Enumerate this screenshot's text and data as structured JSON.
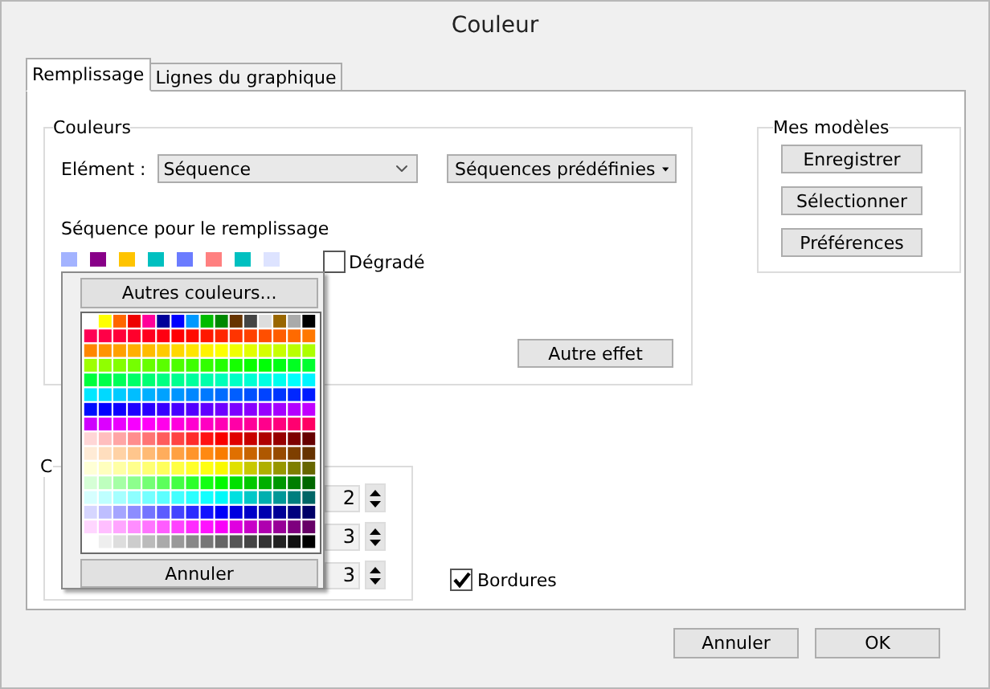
{
  "window": {
    "title": "Couleur"
  },
  "tabs": [
    {
      "label": "Remplissage",
      "selected": true
    },
    {
      "label": "Lignes du graphique",
      "selected": false
    }
  ],
  "colors_group": {
    "legend": "Couleurs",
    "element_label": "Elément :",
    "element_value": "Séquence",
    "presets_button": "Séquences prédéfinies",
    "sequence_label": "Séquence pour le remplissage",
    "swatches": [
      {
        "color": "#a3b3ff"
      },
      {
        "color": "#880088"
      },
      {
        "color": "#ffc400"
      },
      {
        "color": "#00c0c0"
      },
      {
        "color": "#6b7cff"
      },
      {
        "color": "#ff8080"
      },
      {
        "color": "#00c0c0"
      },
      {
        "color": "#dde3ff"
      }
    ],
    "gradient": {
      "label": "Dégradé",
      "checked": false
    },
    "effect_button": "Autre effet"
  },
  "templates_group": {
    "legend": "Mes modèles",
    "buttons": [
      "Enregistrer",
      "Sélectionner",
      "Préférences"
    ]
  },
  "second_group": {
    "legend": "C",
    "spinners": [
      "2",
      "3",
      "3"
    ]
  },
  "borders": {
    "label": "Bordures",
    "checked": true
  },
  "palette_popup": {
    "more_button": "Autres couleurs...",
    "cancel_button": "Annuler"
  },
  "buttons": [
    "Annuler",
    "OK"
  ]
}
